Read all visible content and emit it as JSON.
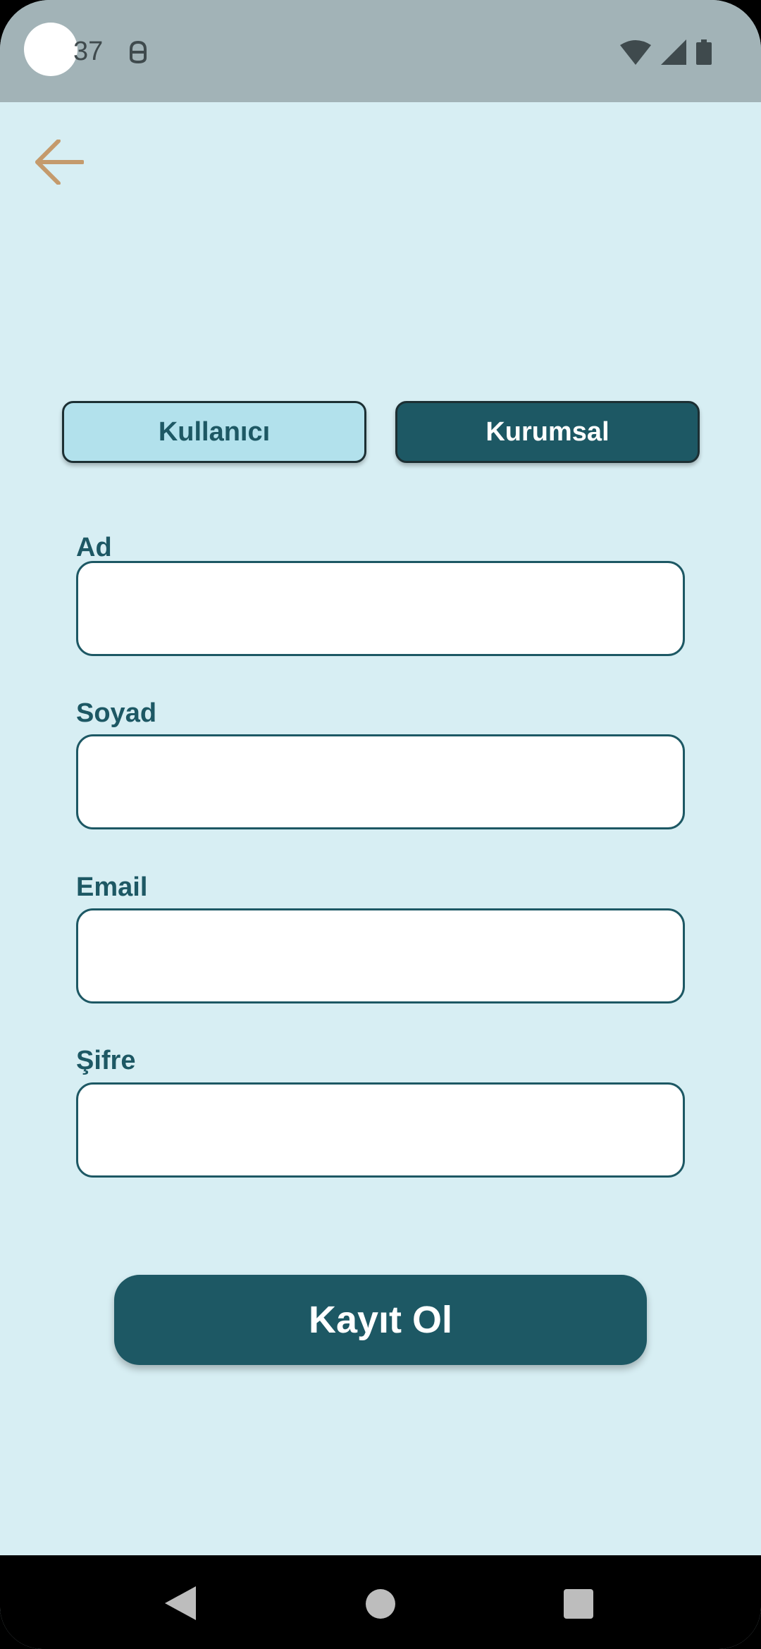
{
  "status_bar": {
    "time": "37"
  },
  "toggle": {
    "user_label": "Kullanıcı",
    "corporate_label": "Kurumsal",
    "selected": "Kurumsal"
  },
  "form": {
    "fields": [
      {
        "label": "Ad",
        "value": ""
      },
      {
        "label": "Soyad",
        "value": ""
      },
      {
        "label": "Email",
        "value": ""
      },
      {
        "label": "Şifre",
        "value": ""
      }
    ],
    "submit_label": "Kayıt Ol"
  },
  "colors": {
    "background": "#d7eef3",
    "primary": "#1d5864",
    "toggle_inactive": "#b2e1ec",
    "back_arrow": "#c49a6c"
  },
  "icons": {
    "back": "arrow-left-icon",
    "nav_back": "triangle-back-icon",
    "nav_home": "circle-home-icon",
    "nav_recents": "square-recents-icon"
  }
}
